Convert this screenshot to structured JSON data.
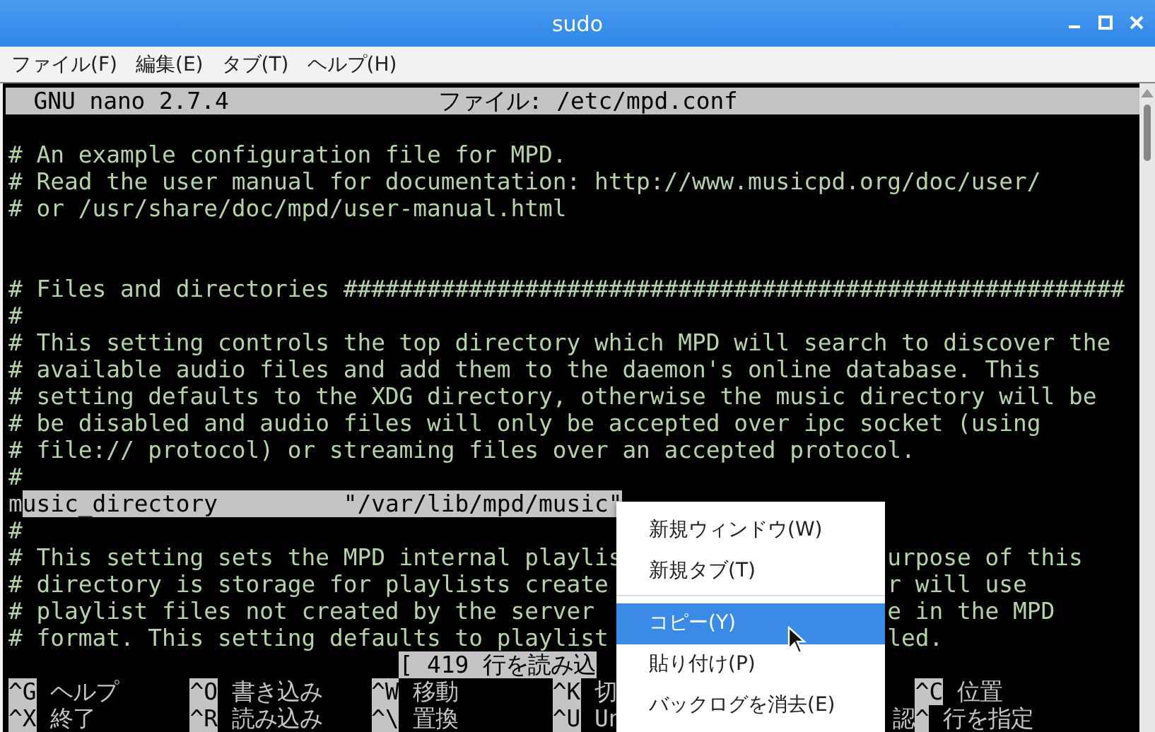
{
  "window": {
    "title": "sudo"
  },
  "menubar": [
    "ファイル(F)",
    "編集(E)",
    "タブ(T)",
    "ヘルプ(H)"
  ],
  "nano_header": {
    "version": "GNU nano 2.7.4",
    "file": "ファイル: /etc/mpd.conf"
  },
  "lines": [
    {
      "kind": "blank"
    },
    {
      "kind": "comment",
      "text": "# An example configuration file for MPD."
    },
    {
      "kind": "comment",
      "text": "# Read the user manual for documentation: http://www.musicpd.org/doc/user/"
    },
    {
      "kind": "comment",
      "text": "# or /usr/share/doc/mpd/user-manual.html"
    },
    {
      "kind": "blank"
    },
    {
      "kind": "blank"
    },
    {
      "kind": "comment",
      "text": "# Files and directories ########################################################"
    },
    {
      "kind": "comment",
      "text": "#"
    },
    {
      "kind": "comment",
      "text": "# This setting controls the top directory which MPD will search to discover the"
    },
    {
      "kind": "comment",
      "text": "# available audio files and add them to the daemon's online database. This"
    },
    {
      "kind": "comment",
      "text": "# setting defaults to the XDG directory, otherwise the music directory will be"
    },
    {
      "kind": "comment",
      "text": "# be disabled and audio files will only be accepted over ipc socket (using"
    },
    {
      "kind": "comment",
      "text": "# file:// protocol) or streaming files over an accepted protocol."
    },
    {
      "kind": "comment",
      "text": "#"
    },
    {
      "kind": "selected",
      "cursor": "m",
      "text": "usic_directory         \"/var/lib/mpd/music\""
    },
    {
      "kind": "comment",
      "text": "#"
    },
    {
      "kind": "split",
      "left": "# This setting sets the MPD internal playlis",
      "right": "urpose of this"
    },
    {
      "kind": "split",
      "left": "# directory is storage for playlists create",
      "right": "r will use"
    },
    {
      "kind": "split",
      "left": "# playlist files not created by the server",
      "right": "e in the MPD"
    },
    {
      "kind": "split",
      "left": "# format. This setting defaults to playlist",
      "right": "led."
    }
  ],
  "status": "[ 419 行を読み込",
  "shortcuts": [
    [
      {
        "key": "^G",
        "label": "ヘルプ"
      },
      {
        "key": "^O",
        "label": "書き込み"
      },
      {
        "key": "^W",
        "label": "移動"
      },
      {
        "key": "^K",
        "label": "切"
      },
      {
        "key": "^C",
        "label": "位置"
      }
    ],
    [
      {
        "key": "^X",
        "label": "終了"
      },
      {
        "key": "^R",
        "label": "読み込み"
      },
      {
        "key": "^\\",
        "label": "置換"
      },
      {
        "key": "^U",
        "label": "Un"
      },
      {
        "label": "認"
      },
      {
        "key": "^",
        "label": "行を指定"
      }
    ]
  ],
  "context_menu": [
    {
      "label": "新規ウィンドウ(W)",
      "selected": false
    },
    {
      "label": "新規タブ(T)",
      "selected": false,
      "separator_after": true
    },
    {
      "label": "コピー(Y)",
      "selected": true
    },
    {
      "label": "貼り付け(P)",
      "selected": false
    },
    {
      "label": "バックログを消去(E)",
      "selected": false
    }
  ]
}
